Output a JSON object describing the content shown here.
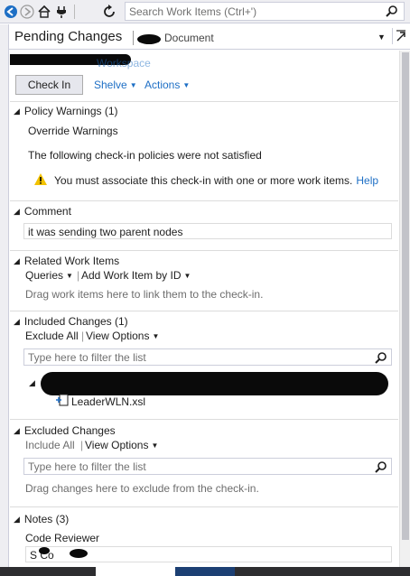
{
  "toolbar": {
    "search_placeholder": "Search Work Items (Ctrl+')"
  },
  "header": {
    "title": "Pending Changes",
    "doc_label": "Document"
  },
  "workspace": {
    "link_partial": "Workspace"
  },
  "actions": {
    "check_in": "Check In",
    "shelve": "Shelve",
    "actions": "Actions"
  },
  "policy": {
    "heading": "Policy Warnings (1)",
    "override": "Override Warnings",
    "message": "The following check-in policies were not satisfied",
    "warning": "You must associate this check-in with one or more work items.",
    "help": "Help"
  },
  "comment": {
    "heading": "Comment",
    "value": "it was sending two parent nodes"
  },
  "related": {
    "heading": "Related Work Items",
    "queries": "Queries",
    "add": "Add Work Item by ID",
    "hint": "Drag work items here to link them to the check-in."
  },
  "included": {
    "heading": "Included Changes (1)",
    "exclude_all": "Exclude All",
    "view_options": "View Options",
    "filter_placeholder": "Type here to filter the list",
    "file": "LeaderWLN.xsl"
  },
  "excluded": {
    "heading": "Excluded Changes",
    "include_all": "Include All",
    "view_options": "View Options",
    "filter_placeholder": "Type here to filter the list",
    "hint": "Drag changes here to exclude from the check-in."
  },
  "notes": {
    "heading": "Notes (3)",
    "reviewer_label": "Code Reviewer",
    "reviewer_value": "S  Co"
  },
  "colors": {
    "link": "#1e6fc5",
    "toolbar_bg": "#eeeef2",
    "warning": "#f2c200"
  }
}
